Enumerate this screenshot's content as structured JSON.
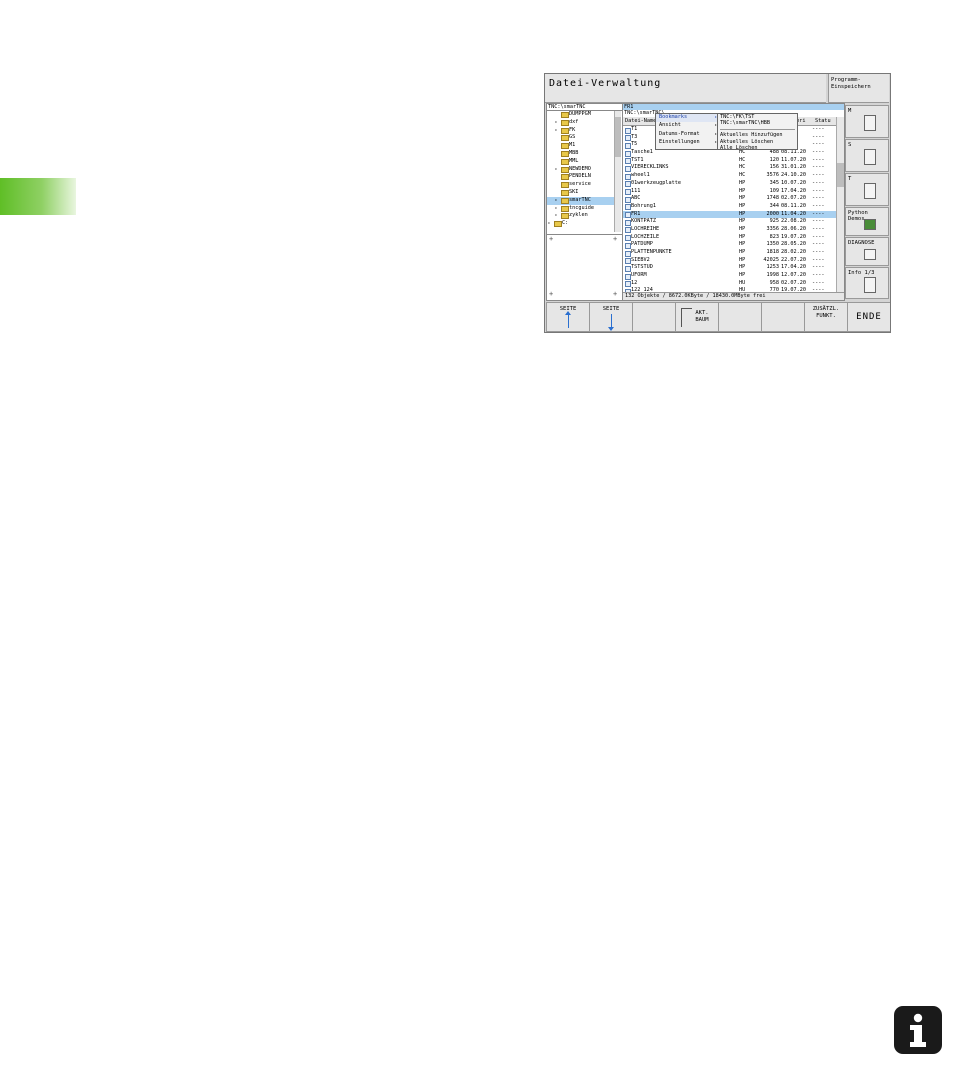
{
  "screen": {
    "title": "Datei-Verwaltung",
    "program_save": "Programm-\nEinspeichern",
    "left_path": "TNC:\\smarTNC",
    "tree": [
      {
        "label": "DUMPPGM",
        "indent": 2,
        "arrow": false,
        "selected": false
      },
      {
        "label": "dxf",
        "indent": 2,
        "arrow": true,
        "selected": false
      },
      {
        "label": "FK",
        "indent": 2,
        "arrow": true,
        "selected": false
      },
      {
        "label": "GS",
        "indent": 2,
        "arrow": false,
        "selected": false
      },
      {
        "label": "M1",
        "indent": 2,
        "arrow": false,
        "selected": false
      },
      {
        "label": "MBB",
        "indent": 2,
        "arrow": false,
        "selected": false
      },
      {
        "label": "MML",
        "indent": 2,
        "arrow": false,
        "selected": false
      },
      {
        "label": "NEWDEMO",
        "indent": 2,
        "arrow": true,
        "selected": false
      },
      {
        "label": "PENDELN",
        "indent": 2,
        "arrow": false,
        "selected": false
      },
      {
        "label": "service",
        "indent": 2,
        "arrow": false,
        "selected": false
      },
      {
        "label": "SKI",
        "indent": 2,
        "arrow": false,
        "selected": false
      },
      {
        "label": "smarTNC",
        "indent": 2,
        "arrow": true,
        "selected": true
      },
      {
        "label": "tncguide",
        "indent": 2,
        "arrow": true,
        "selected": false
      },
      {
        "label": "zyklen",
        "indent": 2,
        "arrow": true,
        "selected": false
      },
      {
        "label": "C:",
        "indent": 1,
        "arrow": true,
        "selected": false
      }
    ],
    "right_path": "FR1",
    "right_path2": "TNC:\\smarTNC\\",
    "header": {
      "name": "Datei-Name",
      "changed": "deri",
      "status": "Statu"
    },
    "files": [
      {
        "name": "T1",
        "type": "HC",
        "size": "",
        "date": "5.20",
        "status": "----",
        "selected": false
      },
      {
        "name": "T3",
        "type": "HC",
        "size": "",
        "date": "6.20",
        "status": "----",
        "selected": false
      },
      {
        "name": "T5",
        "type": "HC",
        "size": "",
        "date": "8.20",
        "status": "----",
        "selected": false
      },
      {
        "name": "Tasche1",
        "type": "HC",
        "size": "488",
        "date": "08.11.20",
        "status": "----",
        "selected": false
      },
      {
        "name": "TST1",
        "type": "HC",
        "size": "120",
        "date": "11.07.20",
        "status": "----",
        "selected": false
      },
      {
        "name": "VIERECKLINKS",
        "type": "HC",
        "size": "156",
        "date": "31.01.20",
        "status": "----",
        "selected": false
      },
      {
        "name": "wheel1",
        "type": "HC",
        "size": "3576",
        "date": "24.10.20",
        "status": "----",
        "selected": false
      },
      {
        "name": "01werkzeugplatte",
        "type": "HP",
        "size": "345",
        "date": "10.07.20",
        "status": "----",
        "selected": false
      },
      {
        "name": "111",
        "type": "HP",
        "size": "109",
        "date": "17.04.20",
        "status": "----",
        "selected": false
      },
      {
        "name": "ABC",
        "type": "HP",
        "size": "1748",
        "date": "02.07.20",
        "status": "----",
        "selected": false
      },
      {
        "name": "Bohrung1",
        "type": "HP",
        "size": "344",
        "date": "08.11.20",
        "status": "----",
        "selected": false
      },
      {
        "name": "FR1",
        "type": "HP",
        "size": "2000",
        "date": "11.04.20",
        "status": "----",
        "selected": true
      },
      {
        "name": "KONTPATZ",
        "type": "HP",
        "size": "925",
        "date": "22.08.20",
        "status": "----",
        "selected": false
      },
      {
        "name": "LOCHREIHE",
        "type": "HP",
        "size": "3356",
        "date": "28.06.20",
        "status": "----",
        "selected": false
      },
      {
        "name": "LOCHZEILE",
        "type": "HP",
        "size": "823",
        "date": "19.07.20",
        "status": "----",
        "selected": false
      },
      {
        "name": "PATDUMP",
        "type": "HP",
        "size": "1350",
        "date": "28.05.20",
        "status": "----",
        "selected": false
      },
      {
        "name": "PLATTENPUNKTE",
        "type": "HP",
        "size": "1818",
        "date": "28.02.20",
        "status": "----",
        "selected": false
      },
      {
        "name": "SIEBV2",
        "type": "HP",
        "size": "42025",
        "date": "22.07.20",
        "status": "----",
        "selected": false
      },
      {
        "name": "TSTSTUD",
        "type": "HP",
        "size": "1253",
        "date": "17.04.20",
        "status": "----",
        "selected": false
      },
      {
        "name": "UFORM",
        "type": "HP",
        "size": "1998",
        "date": "12.07.20",
        "status": "----",
        "selected": false
      },
      {
        "name": "12",
        "type": "HU",
        "size": "958",
        "date": "02.07.20",
        "status": "----",
        "selected": false
      },
      {
        "name": "122_124",
        "type": "HU",
        "size": "770",
        "date": "19.07.20",
        "status": "----",
        "selected": false
      }
    ],
    "status_line": "132 Objekte / 8672.0KByte / 18430.0MByte frei",
    "menu1": [
      {
        "label": "Bookmarks",
        "highlight": true
      },
      {
        "label": "Ansicht",
        "highlight": false
      },
      {
        "label": "Datums-Format",
        "highlight": false
      },
      {
        "label": "Einstellungen",
        "highlight": false
      }
    ],
    "menu2": [
      "TNC:\\FK\\TST",
      "TNC:\\smarTNC\\HBB",
      "Aktuelles Hinzufügen",
      "Aktuelles Löschen",
      "Alle Löschen"
    ],
    "side_softkeys": [
      {
        "label": "M"
      },
      {
        "label": "S"
      },
      {
        "label": "T"
      },
      {
        "label": "Python\nDemos"
      },
      {
        "label": "DIAGNOSE"
      },
      {
        "label": "Info 1/3"
      }
    ],
    "bottom_softkeys": [
      {
        "label": "SEITE"
      },
      {
        "label": "SEITE"
      },
      {
        "label": ""
      },
      {
        "label": "AKT.\nBAUM"
      },
      {
        "label": ""
      },
      {
        "label": ""
      },
      {
        "label": "ZUSÄTZL.\nFUNKT."
      },
      {
        "label": "ENDE"
      }
    ]
  },
  "colors": {
    "accent_green": "#5fbe26",
    "selection_blue": "#a8d0f0",
    "menu_highlight": "#1a3fa8"
  },
  "icons": {
    "corner_info": "info-icon"
  }
}
